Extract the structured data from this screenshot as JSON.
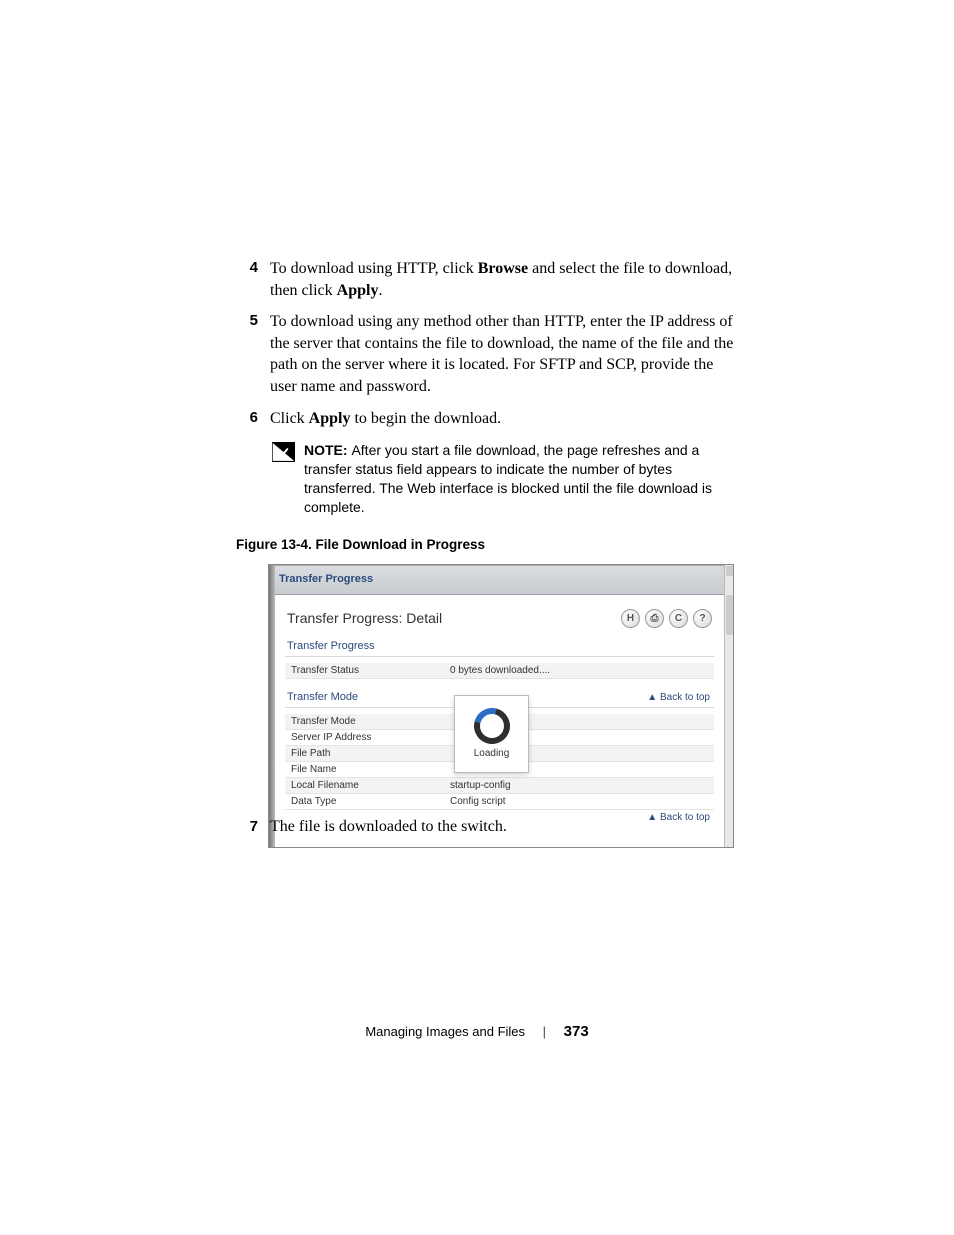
{
  "steps": {
    "s4": {
      "num": "4",
      "text_a": "To download using HTTP, click ",
      "bold_a": "Browse",
      "text_b": " and select the file to download, then click ",
      "bold_b": "Apply",
      "text_c": "."
    },
    "s5": {
      "num": "5",
      "text": "To download using any method other than HTTP, enter the IP address of the server that contains the file to download, the name of the file and the path on the server where it is located. For SFTP and SCP, provide the user name and password."
    },
    "s6": {
      "num": "6",
      "text_a": "Click ",
      "bold_a": "Apply",
      "text_b": " to begin the download."
    },
    "s7": {
      "num": "7",
      "text": "The file is downloaded to the switch."
    }
  },
  "note": {
    "label": "NOTE: ",
    "text": "After you start a file download, the page refreshes and a transfer status field appears to indicate the number of bytes transferred. The Web interface is blocked until the file download is complete."
  },
  "figure": {
    "caption": "Figure 13-4.    File Download in Progress"
  },
  "screenshot": {
    "tab": "Transfer Progress",
    "title": "Transfer Progress: Detail",
    "icons": {
      "save": "H",
      "print": "⎙",
      "refresh": "C",
      "help": "?"
    },
    "sec1": {
      "header": "Transfer Progress",
      "row1_label": "Transfer Status",
      "row1_value": "0 bytes downloaded...."
    },
    "sec2": {
      "header": "Transfer Mode",
      "backtop": "▲ Back to top",
      "rows": {
        "r1": {
          "label": "Transfer Mode",
          "value": ""
        },
        "r2": {
          "label": "Server IP Address",
          "value": ""
        },
        "r3": {
          "label": "File Path",
          "value": ""
        },
        "r4": {
          "label": "File Name",
          "value": ""
        },
        "r5": {
          "label": "Local Filename",
          "value": "startup-config"
        },
        "r6": {
          "label": "Data Type",
          "value": "Config script"
        }
      },
      "backtop2": "▲ Back to top"
    },
    "loading": "Loading"
  },
  "footer": {
    "section": "Managing Images and Files",
    "page": "373"
  }
}
